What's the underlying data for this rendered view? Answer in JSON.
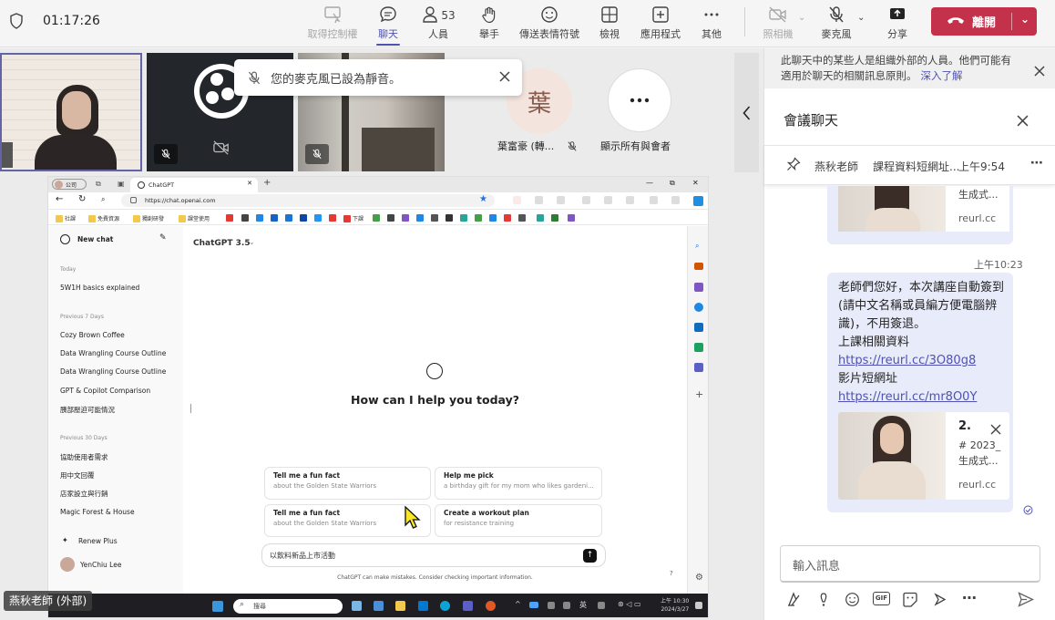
{
  "topbar": {
    "timer": "01:17:26",
    "stop_control": "取得控制權",
    "chat": "聊天",
    "people": "人員",
    "people_count": "53",
    "raise_hand": "舉手",
    "reactions": "傳送表情符號",
    "view": "檢視",
    "apps": "應用程式",
    "more": "其他",
    "camera": "照相機",
    "mic": "麥克風",
    "share": "分享",
    "leave": "離開"
  },
  "toast": {
    "text": "您的麥克風已設為靜音。"
  },
  "participants": {
    "initial": "葉",
    "name1": "葉富豪 (轉...",
    "show_all": "顯示所有與會者",
    "presenter": "燕秋老師 (外部)"
  },
  "browser": {
    "profile": "公司",
    "tab_title": "ChatGPT",
    "url": "https://chat.openai.com",
    "bookmarks": [
      "社課",
      "免費資源",
      "獨創研發",
      "課堂使用"
    ],
    "bookmark_extra": "下課"
  },
  "chatgpt": {
    "new_chat": "New chat",
    "model": "ChatGPT 3.5",
    "today_label": "Today",
    "item_today": "5W1H basics explained",
    "prev7_label": "Previous 7 Days",
    "prev7": [
      "Cozy Brown Coffee",
      "Data Wrangling Course Outline",
      "Data Wrangling Course Outline",
      "GPT & Copilot Comparison",
      "胰部壓迫可能情況"
    ],
    "prev30_label": "Previous 30 Days",
    "prev30": [
      "協助使用者需求",
      "用中文回覆",
      "店家設立與行銷",
      "Magic Forest & House"
    ],
    "renew": "Renew Plus",
    "user": "YenChiu Lee",
    "heading": "How can I help you today?",
    "suggestions": [
      {
        "title": "Tell me a fun fact",
        "sub": "about the Golden State Warriors"
      },
      {
        "title": "Help me pick",
        "sub": "a birthday gift for my mom who likes gardeni..."
      },
      {
        "title": "Tell me a fun fact",
        "sub": "about the Golden State Warriors"
      },
      {
        "title": "Create a workout plan",
        "sub": "for resistance training"
      }
    ],
    "input_value": "以飲料新品上市活動",
    "disclaimer": "ChatGPT can make mistakes. Consider checking important information.",
    "help": "?"
  },
  "taskbar": {
    "search": "搜尋",
    "ime": "英",
    "time": "上午 10:30",
    "date": "2024/3/27"
  },
  "chat": {
    "banner": "此聊天中的某些人是組織外部的人員。他們可能有適用於聊天的相關訊息原則。",
    "learn_more": "深入了解",
    "title": "會議聊天",
    "pinned_author": "燕秋老師",
    "pinned_text": "課程資料短網址...",
    "pinned_time": "上午9:54",
    "card1": {
      "snippet": "生成式...",
      "domain": "reurl.cc"
    },
    "msg_time": "上午10:23",
    "msg_lines": [
      "老師們您好，本次講座自動簽到(請中文名稱或員編方便電腦辨識)，不用簽退。",
      "上課相關資料"
    ],
    "link1": "https://reurl.cc/3O80g8",
    "video_label": "影片短網址",
    "link2": "https://reurl.cc/mr8O0Y",
    "card2": {
      "title": "2.",
      "snippet1": "# 2023_",
      "snippet2": "生成式...",
      "domain": "reurl.cc"
    },
    "compose_placeholder": "輸入訊息"
  },
  "colors": {
    "accent": "#4f52b2",
    "leave": "#c4314b",
    "bubble": "#e8ebfa"
  }
}
